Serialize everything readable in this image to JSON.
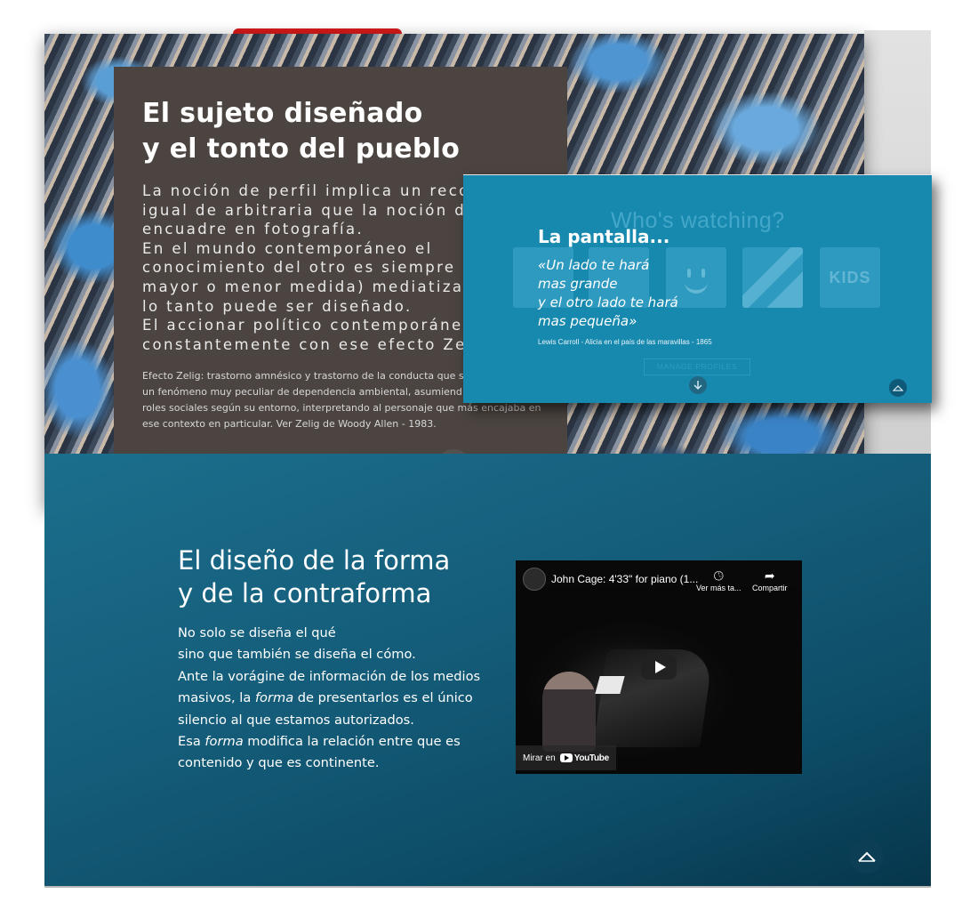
{
  "hero": {
    "title": "El sujeto diseñado\ny el tonto del pueblo",
    "body": "La noción de perfil implica un reco\nigual de arbitraria que la noción de\nencuadre en fotografía.\nEn el mundo contemporáneo el\nconocimiento del otro es siempre (\nmayor o menor medida) mediatizad\nlo tanto puede ser diseñado.\nEl accionar político contemporáneo\nconstantemente con ese efecto Zel",
    "note": "Efecto Zelig: trastorno amnésico y trastorno de la conducta que se\nun fenómeno muy peculiar de dependencia ambiental, asumiend\nroles sociales según su entorno, interpretando al personaje que más encajaba en\nese contexto en particular. Ver Zelig de Woody Allen - 1983."
  },
  "popup": {
    "faint_title": "Who's watching?",
    "kids_label": "KIDS",
    "manage_label": "MANAGE PROFILES",
    "title": "La pantalla...",
    "quote": "«Un lado te hará\nmas grande\ny el otro lado te hará\nmas pequeña»",
    "citation": "Lewis Carroll - Alicia en el país de las maravillas - 1865"
  },
  "section2": {
    "title": "El diseño de la forma\ny de la contraforma",
    "body": {
      "line1": "No solo se diseña el qué",
      "line2": "sino que también se diseña el cómo.",
      "line3": "Ante la vorágine de información de los medios masivos, la ",
      "line3_em": "forma",
      "line3_end": " de presentarlos es el único silencio al que estamos autorizados.",
      "line4": "Esa ",
      "line4_em": "forma",
      "line4_end": " modifica la relación entre que es contenido y que es continente."
    }
  },
  "video": {
    "title": "John Cage: 4'33\" for piano (1...",
    "watch_later_label": "Ver más ta...",
    "share_label": "Compartir",
    "watch_on_label": "Mirar en",
    "youtube_label": "YouTube"
  },
  "icons": {
    "down_arrow": "arrow-down-icon",
    "up_arrow": "chevron-up-icon",
    "play": "play-icon",
    "clock": "clock-icon",
    "share": "share-icon"
  },
  "colors": {
    "hero_panel": "#4b4440",
    "teal_section": "#145c79",
    "popup_bg": "#1789ae"
  }
}
